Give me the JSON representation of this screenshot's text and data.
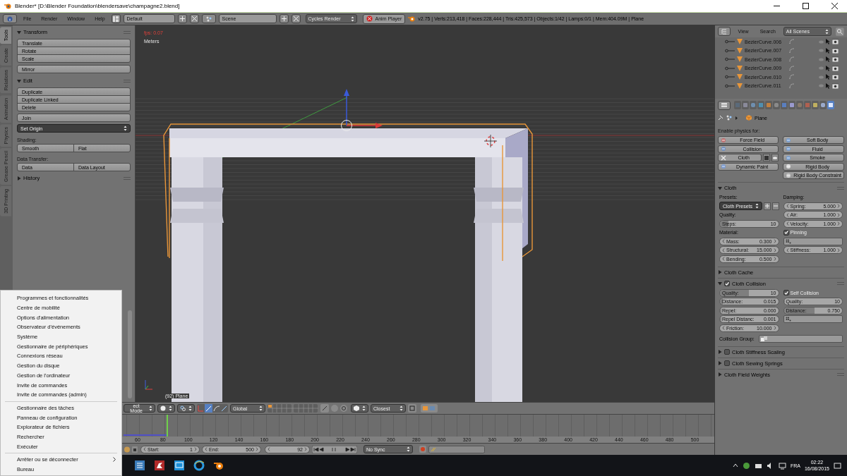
{
  "window": {
    "title": "Blender* [D:\\Blender Foundation\\blendersave\\champagne2.blend]"
  },
  "info_header": {
    "menus": [
      "File",
      "Render",
      "Window",
      "Help"
    ],
    "layout": "Default",
    "scene": "Scene",
    "engine": "Cycles Render",
    "anim_player": "Anim Player",
    "stats": "v2.75 | Verts:213,418 | Faces:228,444 | Tris:425,573 | Objects:1/42 | Lamps:0/1 | Mem:404.09M | Plane"
  },
  "tool_tabs": [
    {
      "label": "Tools",
      "selected": true
    },
    {
      "label": "Create",
      "selected": false
    },
    {
      "label": "Relations",
      "selected": false
    },
    {
      "label": "Animation",
      "selected": false
    },
    {
      "label": "Physics",
      "selected": false
    },
    {
      "label": "Grease Pencil",
      "selected": false
    },
    {
      "label": "3D Printing",
      "selected": false
    }
  ],
  "tool_panels": [
    {
      "title": "Transform",
      "expanded": true,
      "rows": [
        {
          "kind": "stack",
          "buttons": [
            "Translate",
            "Rotate",
            "Scale"
          ]
        },
        {
          "kind": "stack",
          "buttons": [
            "Mirror"
          ]
        }
      ]
    },
    {
      "title": "Edit",
      "expanded": true,
      "rows": [
        {
          "kind": "stack",
          "buttons": [
            "Duplicate",
            "Duplicate Linked",
            "Delete"
          ]
        },
        {
          "kind": "stack",
          "buttons": [
            "Join"
          ]
        },
        {
          "kind": "dropdown",
          "text": "Set Origin"
        },
        {
          "kind": "label",
          "text": "Shading:"
        },
        {
          "kind": "pair",
          "buttons": [
            "Smooth",
            "Flat"
          ]
        },
        {
          "kind": "label",
          "text": "Data Transfer:"
        },
        {
          "kind": "pair",
          "buttons": [
            "Data",
            "Data Layout"
          ]
        }
      ]
    },
    {
      "title": "History",
      "expanded": false
    }
  ],
  "viewport": {
    "fps": "fps: 0.07",
    "units": "Meters",
    "object": "(92) Plane"
  },
  "viewport_header": {
    "mode": "ect Mode",
    "orientation": "Global",
    "snap_target": "Closest"
  },
  "timeline": {
    "ticks": [
      "60",
      "80",
      "100",
      "120",
      "140",
      "160",
      "180",
      "200",
      "220",
      "240",
      "260",
      "280",
      "300",
      "320",
      "340",
      "360",
      "380",
      "400",
      "420",
      "440",
      "460",
      "480",
      "500"
    ]
  },
  "timeline_header": {
    "start": {
      "label": "Start:",
      "value": "1"
    },
    "end": {
      "label": "End:",
      "value": "500"
    },
    "current": "92",
    "sync": "No Sync"
  },
  "outliner": {
    "view": "View",
    "search": "Search",
    "filter": "All Scenes",
    "rows": [
      {
        "name": "BezierCurve.006"
      },
      {
        "name": "BezierCurve.007"
      },
      {
        "name": "BezierCurve.008"
      },
      {
        "name": "BezierCurve.009"
      },
      {
        "name": "BezierCurve.010"
      },
      {
        "name": "BezierCurve.011"
      }
    ]
  },
  "properties": {
    "tabs": [
      {
        "selected": false
      },
      {
        "selected": false
      },
      {
        "selected": false
      },
      {
        "selected": false
      },
      {
        "selected": false
      },
      {
        "selected": false
      },
      {
        "selected": false
      },
      {
        "selected": false
      },
      {
        "selected": false
      },
      {
        "selected": false
      },
      {
        "selected": false
      },
      {
        "selected": false
      },
      {
        "selected": true
      }
    ],
    "breadcrumb": "Plane",
    "enable_label": "Enable physics for:",
    "physics_buttons": [
      {
        "label": "Force Field",
        "enabled": false
      },
      {
        "label": "Soft Body",
        "enabled": false
      },
      {
        "label": "Collision",
        "enabled": false
      },
      {
        "label": "Fluid",
        "enabled": false
      },
      {
        "label": "Cloth",
        "enabled": true
      },
      {
        "label": "Smoke",
        "enabled": false
      },
      {
        "label": "Dynamic Paint",
        "enabled": false
      },
      {
        "label": "Rigid Body",
        "enabled": false
      },
      {
        "label": "Rigid Body Constraint",
        "enabled": false
      }
    ],
    "cloth": {
      "title": "Cloth",
      "expanded": true,
      "left": [
        {
          "kind": "label",
          "text": "Presets:"
        },
        {
          "kind": "preset",
          "text": "Cloth Presets"
        },
        {
          "kind": "label",
          "text": "Quality:"
        },
        {
          "kind": "slider",
          "label": "Steps:",
          "value": "10",
          "level": 0.15
        },
        {
          "kind": "label",
          "text": "Material:"
        },
        {
          "kind": "number",
          "label": "Mass:",
          "value": "0.300"
        },
        {
          "kind": "number",
          "label": "Structural:",
          "value": "15.000"
        },
        {
          "kind": "number",
          "label": "Bending:",
          "value": "0.500"
        }
      ],
      "right": [
        {
          "kind": "label",
          "text": "Damping:"
        },
        {
          "kind": "number",
          "label": "Spring:",
          "value": "5.000"
        },
        {
          "kind": "number",
          "label": "Air:",
          "value": "1.000"
        },
        {
          "kind": "number",
          "label": "Velocity:",
          "value": "1.000"
        },
        {
          "kind": "check",
          "label": "Pinning",
          "checked": true
        },
        {
          "kind": "group"
        },
        {
          "kind": "number",
          "label": "Stiffness:",
          "value": "1.000"
        }
      ]
    },
    "subpanels": [
      {
        "title": "Cloth Cache",
        "expanded": false
      },
      {
        "title": "Cloth Collision",
        "expanded": true,
        "checked": true,
        "left": [
          {
            "kind": "slider",
            "label": "Quality:",
            "value": "10",
            "level": 0.5
          },
          {
            "kind": "slider",
            "label": "Distance:",
            "value": "0.015",
            "level": 0.05
          },
          {
            "kind": "slider",
            "label": "Repel:",
            "value": "0.000",
            "level": 0.03
          },
          {
            "kind": "slider",
            "label": "Repel Distanc:",
            "value": "0.001",
            "level": 0.03
          },
          {
            "kind": "number",
            "label": "Friction:",
            "value": "10.000"
          }
        ],
        "right": [
          {
            "kind": "check",
            "label": "Self Collision",
            "checked": true
          },
          {
            "kind": "slider",
            "label": "Quality:",
            "value": "10",
            "level": 0.02
          },
          {
            "kind": "slider",
            "label": "Distance:",
            "value": "0.750",
            "level": 0.53
          },
          {
            "kind": "group"
          }
        ],
        "footer": {
          "label": "Collision Group:"
        }
      },
      {
        "title": "Cloth Stiffness Scaling",
        "expanded": false,
        "checked": false
      },
      {
        "title": "Cloth Sewing Springs",
        "expanded": false,
        "checked": false
      },
      {
        "title": "Cloth Field Weights",
        "expanded": false
      }
    ]
  },
  "taskbar": {
    "language": "FRA",
    "time": "02:22",
    "date": "16/08/2015"
  },
  "context_menu": {
    "groups": [
      [
        {
          "label": "Programmes et fonctionnalités",
          "submenu": false
        },
        {
          "label": "Centre de mobilité",
          "submenu": false
        },
        {
          "label": "Options d'alimentation",
          "submenu": false
        },
        {
          "label": "Observateur d'événements",
          "submenu": false
        },
        {
          "label": "Système",
          "submenu": false
        },
        {
          "label": "Gestionnaire de périphériques",
          "submenu": false
        },
        {
          "label": "Connexions réseau",
          "submenu": false
        },
        {
          "label": "Gestion du disque",
          "submenu": false
        },
        {
          "label": "Gestion de l'ordinateur",
          "submenu": false
        },
        {
          "label": "Invite de commandes",
          "submenu": false
        },
        {
          "label": "Invite de commandes (admin)",
          "submenu": false
        }
      ],
      [
        {
          "label": "Gestionnaire des tâches",
          "submenu": false
        },
        {
          "label": "Panneau de configuration",
          "submenu": false
        },
        {
          "label": "Explorateur de fichiers",
          "submenu": false
        },
        {
          "label": "Rechercher",
          "submenu": false
        },
        {
          "label": "Exécuter",
          "submenu": false
        }
      ],
      [
        {
          "label": "Arrêter ou se déconnecter",
          "submenu": true
        },
        {
          "label": "Bureau",
          "submenu": false
        }
      ]
    ]
  }
}
